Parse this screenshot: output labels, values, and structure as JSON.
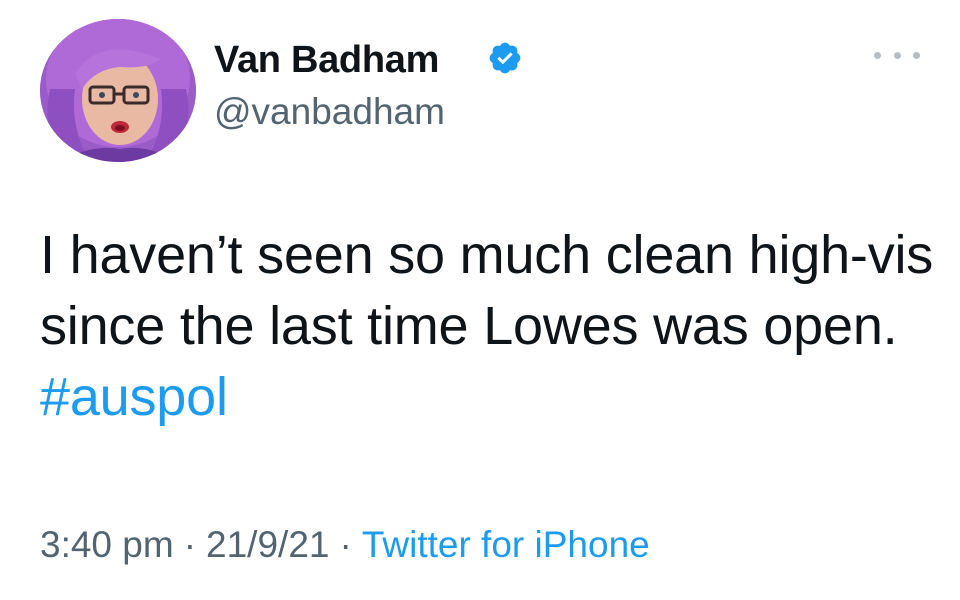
{
  "author": {
    "display_name": "Van Badham",
    "handle": "@vanbadham",
    "verified": true,
    "verified_color": "#1d9bf0",
    "avatar_icon": "profile-photo"
  },
  "tweet": {
    "text_before": "I haven’t seen so much clean high-vis since the last time Lowes was open.",
    "hashtag": "#auspol"
  },
  "meta": {
    "time": "3:40 pm",
    "separator": "·",
    "date": "21/9/21",
    "source": "Twitter for iPhone"
  },
  "more_icon": "more-options-icon",
  "colors": {
    "text": "#0f1419",
    "secondary": "#536471",
    "link": "#1d9bf0"
  }
}
